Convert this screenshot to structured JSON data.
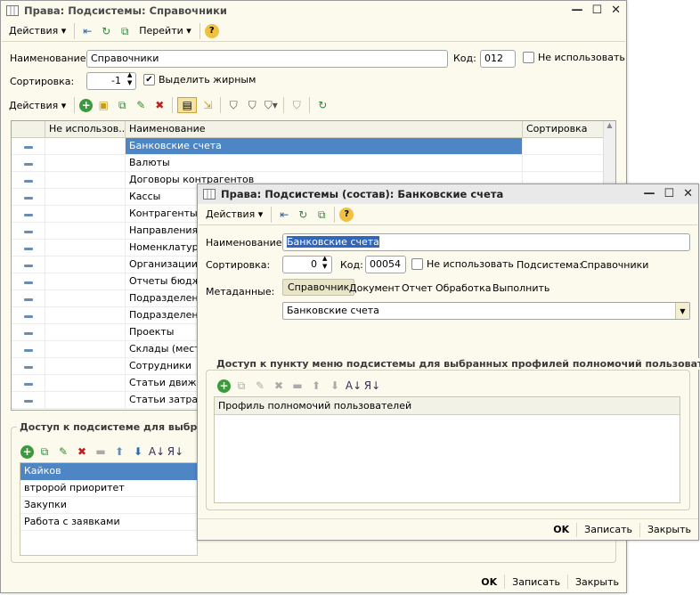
{
  "main_window": {
    "title": "Права: Подсистемы: Справочники",
    "toolbar": {
      "actions": "Действия",
      "goto": "Перейти"
    },
    "name_label": "Наименование:",
    "name_value": "Справочники",
    "code_label": "Код:",
    "code_value": "012",
    "not_use_label": "Не использовать",
    "sort_label": "Сортировка:",
    "sort_value": "-1",
    "bold_label": "Выделить жирным",
    "grid_actions": "Действия",
    "grid": {
      "headers": [
        "Не использов...",
        "Наименование",
        "Сортировка"
      ],
      "rows": [
        {
          "name": "Банковские счета"
        },
        {
          "name": "Валюты"
        },
        {
          "name": "Договоры контрагентов"
        },
        {
          "name": "Кассы"
        },
        {
          "name": "Контрагенты"
        },
        {
          "name": "Направления"
        },
        {
          "name": "Номенклатура"
        },
        {
          "name": "Организации"
        },
        {
          "name": "Отчеты бюдже"
        },
        {
          "name": "Подразделени"
        },
        {
          "name": "Подразделени"
        },
        {
          "name": "Проекты"
        },
        {
          "name": "Склады (места"
        },
        {
          "name": "Сотрудники"
        },
        {
          "name": "Статьи движен"
        },
        {
          "name": "Статьи затрат"
        }
      ]
    },
    "access_group_title": "Доступ к подсистеме для выбра",
    "access_list": {
      "header": "Кайков",
      "items": [
        "втророй приоритет",
        "Закупки",
        "Работа с заявками"
      ]
    },
    "buttons": {
      "ok": "OK",
      "save": "Записать",
      "close": "Закрыть"
    }
  },
  "sub_window": {
    "title": "Права: Подсистемы (состав): Банковские счета",
    "toolbar": {
      "actions": "Действия"
    },
    "name_label": "Наименование:",
    "name_value": "Банковские счета",
    "sort_label": "Сортировка:",
    "sort_value": "0",
    "code_label": "Код:",
    "code_value": "00054",
    "not_use_label": "Не использовать",
    "subsystem_label": "Подсистема:",
    "subsystem_value": "Справочники",
    "metadata_label": "Метаданные:",
    "metadata_types": [
      "Справочник",
      "Документ",
      "Отчет",
      "Обработка",
      "Выполнить"
    ],
    "metadata_value": "Банковские счета",
    "access_group_title": "Доступ к пункту меню подсистемы для выбранных профилей полномочий пользоват...",
    "profile_header": "Профиль полномочий пользователей",
    "buttons": {
      "ok": "OK",
      "save": "Записать",
      "close": "Закрыть"
    }
  }
}
